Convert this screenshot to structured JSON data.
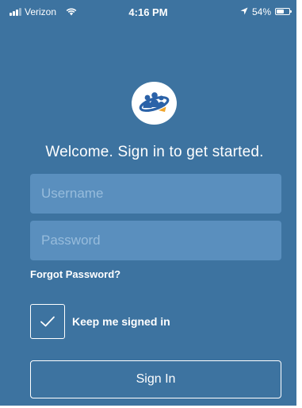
{
  "status_bar": {
    "carrier": "Verizon",
    "time": "4:16 PM",
    "battery": "54%",
    "icons": {
      "signal": "signal-bars-icon",
      "wifi": "wifi-icon",
      "location": "location-arrow-icon",
      "battery": "battery-icon"
    }
  },
  "logo": {
    "icon": "team-orbit-logo"
  },
  "welcome": "Welcome. Sign in to get started.",
  "form": {
    "username_placeholder": "Username",
    "username_value": "",
    "password_placeholder": "Password",
    "password_value": "",
    "forgot_password": "Forgot Password?",
    "keep_signed_in_label": "Keep me signed in",
    "keep_signed_in_checked": true,
    "sign_in_label": "Sign In"
  },
  "colors": {
    "background": "#3d73a0",
    "field_background": "#5a8fbe",
    "placeholder": "#97bcdc",
    "text": "#ffffff",
    "logo_accent_blue": "#2b62a8",
    "logo_accent_orange": "#f0a52c"
  }
}
